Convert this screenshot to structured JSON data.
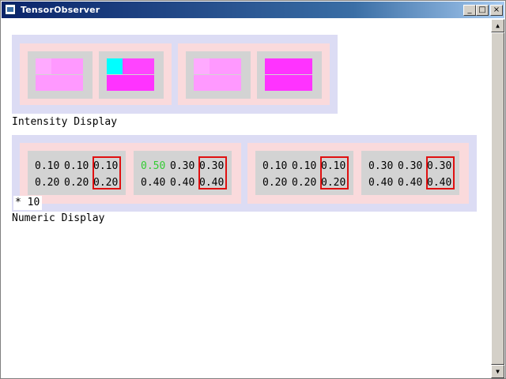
{
  "window": {
    "title": "TensorObserver",
    "minimize_glyph": "_",
    "maximize_glyph": "□",
    "close_glyph": "×"
  },
  "scrollbar": {
    "up_glyph": "▲",
    "down_glyph": "▼"
  },
  "intensity": {
    "label": "Intensity Display",
    "groups": [
      [
        [
          [
            "#ffaaff",
            "#ff99ff",
            "#ff99ff"
          ],
          [
            "#ff99ff",
            "#ff99ff",
            "#ff99ff"
          ]
        ],
        [
          [
            "#00ffff",
            "#ff44ff",
            "#ff44ff"
          ],
          [
            "#ff33ff",
            "#ff33ff",
            "#ff33ff"
          ]
        ]
      ],
      [
        [
          [
            "#ffaaff",
            "#ff99ff",
            "#ff99ff"
          ],
          [
            "#ff99ff",
            "#ff99ff",
            "#ff99ff"
          ]
        ],
        [
          [
            "#ff33ff",
            "#ff33ff",
            "#ff33ff"
          ],
          [
            "#ff33ff",
            "#ff33ff",
            "#ff33ff"
          ]
        ]
      ]
    ]
  },
  "numeric": {
    "label": "Numeric Display",
    "scale": "* 10",
    "groups": [
      [
        [
          [
            "0.10",
            "0.10",
            "0.10"
          ],
          [
            "0.20",
            "0.20",
            "0.20"
          ]
        ],
        [
          [
            "0.50",
            "0.30",
            "0.30"
          ],
          [
            "0.40",
            "0.40",
            "0.40"
          ]
        ]
      ],
      [
        [
          [
            "0.10",
            "0.10",
            "0.10"
          ],
          [
            "0.20",
            "0.20",
            "0.20"
          ]
        ],
        [
          [
            "0.30",
            "0.30",
            "0.30"
          ],
          [
            "0.40",
            "0.40",
            "0.40"
          ]
        ]
      ]
    ],
    "highlight": {
      "group": 0,
      "tensor": 1,
      "row": 0,
      "col": 0,
      "color": "#33cc33"
    },
    "selected_column": 2,
    "selection_color": "#e01010"
  }
}
